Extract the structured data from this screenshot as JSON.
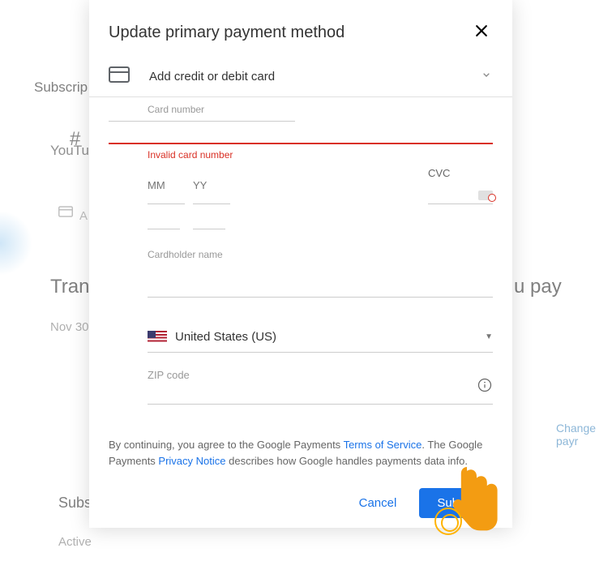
{
  "background": {
    "subscript": "Subscrip",
    "youtu": "YouTu",
    "a": "A",
    "tran": "Tran",
    "upay": "u pay",
    "nov": "Nov 30",
    "change": "Change payr",
    "subs2": "Subs",
    "active": "Active"
  },
  "modal": {
    "title": "Update primary payment method",
    "card_type": "Add credit or debit card",
    "card_number_label": "Card number",
    "card_number_value": "",
    "card_number_error": "Invalid card number",
    "mm_placeholder": "MM",
    "yy_placeholder": "YY",
    "cvc_label": "CVC",
    "cardholder_name_label": "Cardholder name",
    "cardholder_name_value": "",
    "country_label": "United States (US)",
    "zip_label": "ZIP code",
    "legal_part1": "By continuing, you agree to the Google Payments ",
    "tos_link": "Terms of Service",
    "legal_part2": ". The Google Payments ",
    "privacy_link": "Privacy Notice",
    "legal_part3": " describes how Google handles payments data info.",
    "cancel": "Cancel",
    "submit": "Submit"
  }
}
